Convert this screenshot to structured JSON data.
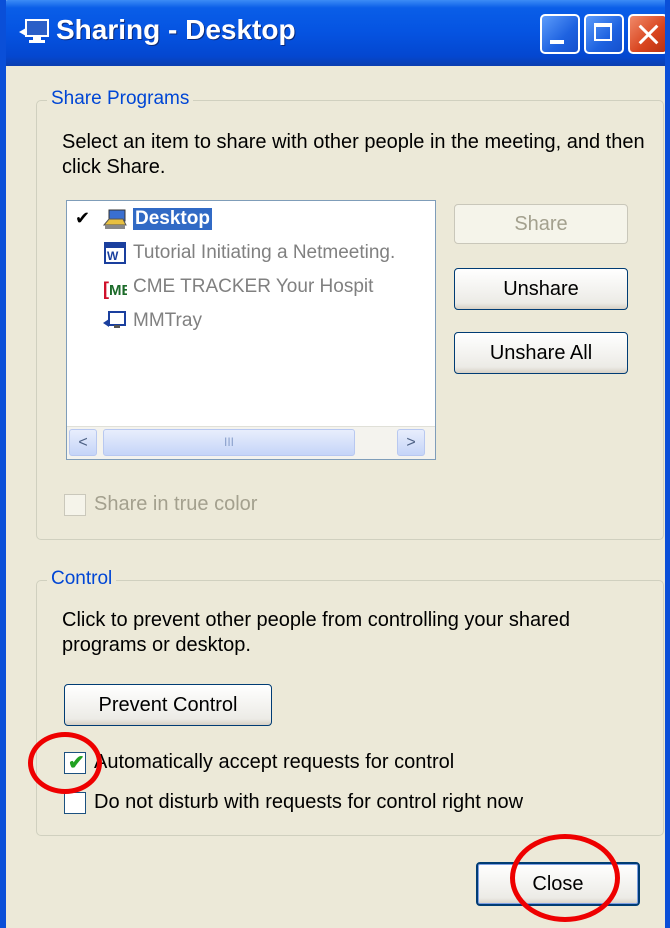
{
  "window": {
    "title": "Sharing - Desktop",
    "colors": {
      "titlebar": "#0553e1",
      "face": "#ece9d8",
      "group_label": "#0046d5",
      "annotation": "#ee0000"
    }
  },
  "share_programs": {
    "legend": "Share Programs",
    "description": "Select an item to share with other people in the meeting, and then click Share.",
    "items": [
      {
        "label": "Desktop",
        "checked": true,
        "selected": true,
        "icon": "desktop-share-icon"
      },
      {
        "label": "Tutorial Initiating a Netmeeting.",
        "checked": false,
        "selected": false,
        "icon": "word-document-icon"
      },
      {
        "label": "CME TRACKER   Your Hospit",
        "checked": false,
        "selected": false,
        "icon": "cme-tracker-icon"
      },
      {
        "label": "MMTray",
        "checked": false,
        "selected": false,
        "icon": "monitor-icon"
      }
    ],
    "scrollbar": {
      "left": "<",
      "right": ">",
      "thumb_grip": "III"
    },
    "buttons": {
      "share": "Share",
      "unshare": "Unshare",
      "unshare_all": "Unshare All"
    },
    "true_color": {
      "label": "Share in true color",
      "checked": false,
      "enabled": false
    }
  },
  "control": {
    "legend": "Control",
    "description": "Click to prevent other people from controlling your shared programs or desktop.",
    "prevent_button": "Prevent Control",
    "auto_accept": {
      "label": "Automatically accept requests for control",
      "checked": true
    },
    "do_not_disturb": {
      "label": "Do not disturb with requests for control right now",
      "checked": false
    }
  },
  "footer": {
    "close_button": "Close"
  }
}
